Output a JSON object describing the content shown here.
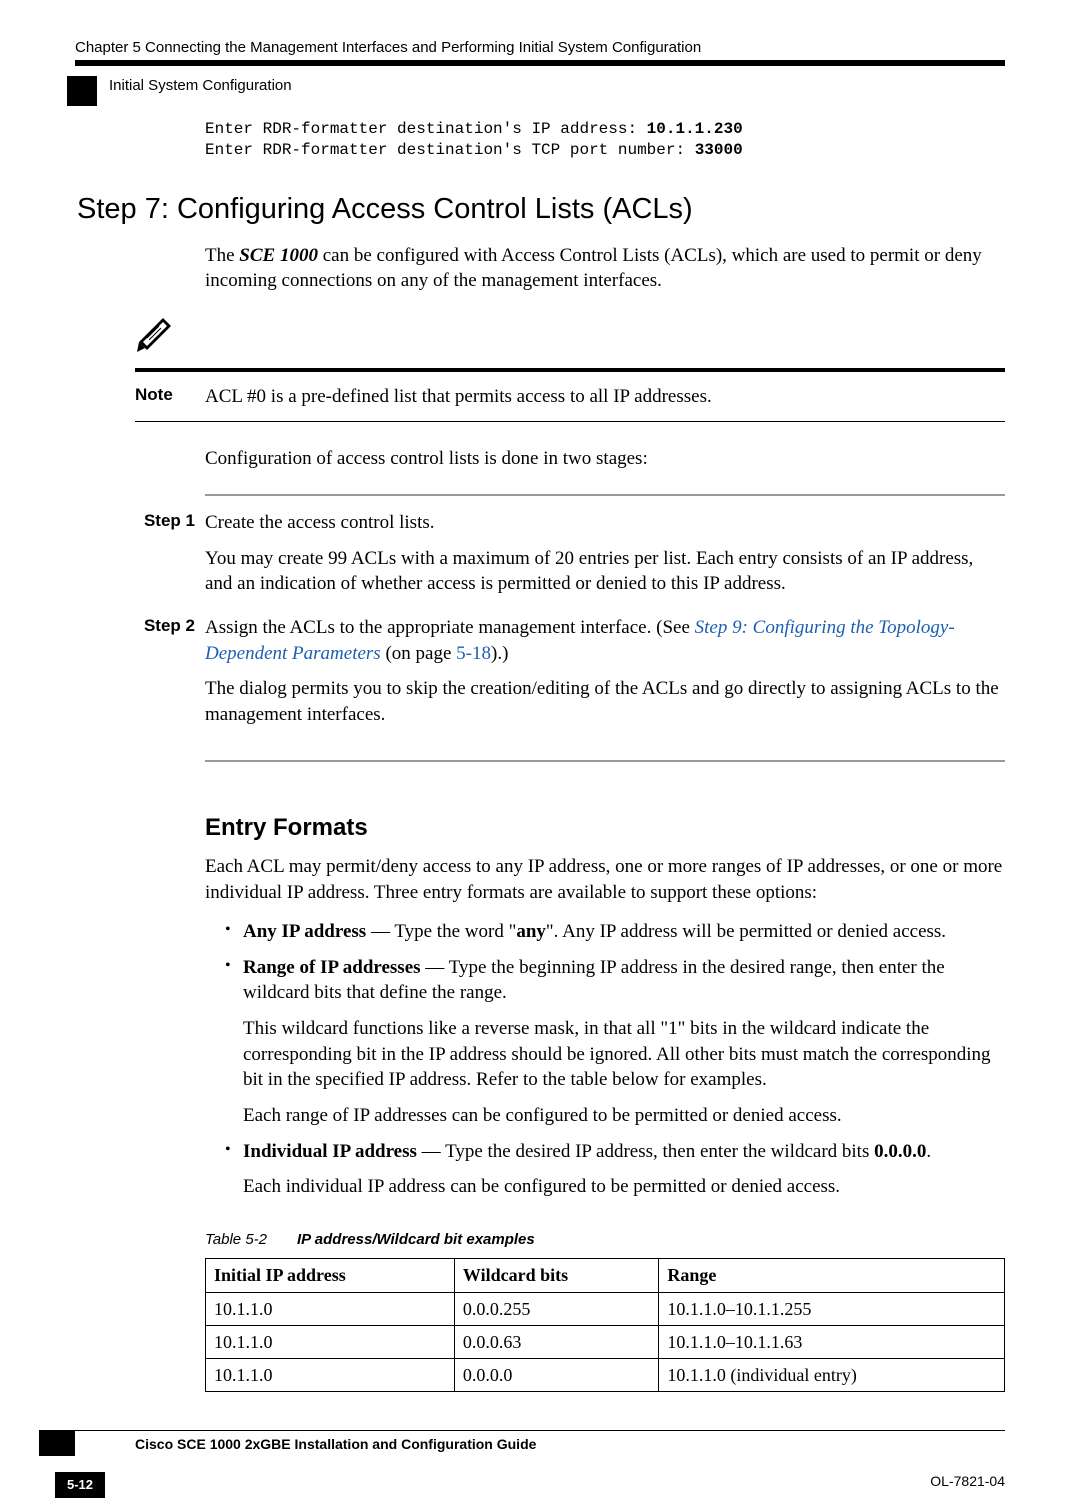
{
  "header": {
    "chapter": "Chapter 5      Connecting the Management Interfaces and Performing Initial System Configuration",
    "section": "Initial System Configuration"
  },
  "code": {
    "line1_label": "Enter RDR-formatter destination's IP address: ",
    "line1_value": "10.1.1.230",
    "line2_label": "Enter RDR-formatter destination's TCP port number: ",
    "line2_value": "33000"
  },
  "title": "Step 7: Configuring Access Control Lists (ACLs)",
  "intro_pre": "The ",
  "intro_device": "SCE 1000",
  "intro_post": " can be configured with Access Control Lists (ACLs), which are used to permit or deny incoming connections on any of the management interfaces.",
  "note": {
    "label": "Note",
    "text": "ACL #0 is a pre-defined list that permits access to all IP addresses."
  },
  "config_intro": "Configuration of access control lists is done in two stages:",
  "steps": {
    "s1_label": "Step 1",
    "s1_p1": "Create the access control lists.",
    "s1_p2": "You may create 99 ACLs with a maximum of 20 entries per list. Each entry consists of an IP address, and an indication of whether access is permitted or denied to this IP address.",
    "s2_label": "Step 2",
    "s2_pre": "Assign the ACLs to the appropriate management interface. (See ",
    "s2_link": "Step 9: Configuring the Topology-Dependent Parameters",
    "s2_mid": " (on page ",
    "s2_page": "5-18",
    "s2_post": ").)",
    "s2_p2": "The dialog permits you to skip the creation/editing of the ACLs and go directly to assigning ACLs to the management interfaces."
  },
  "entry": {
    "heading": "Entry Formats",
    "intro": "Each ACL may permit/deny access to any IP address, one or more ranges of IP addresses, or one or more individual IP address. Three entry formats are available to support these options:",
    "li1_label": "Any IP address",
    "li1_text_a": " — Type the word \"",
    "li1_text_b": "any",
    "li1_text_c": "\". Any IP address will be permitted or denied access.",
    "li2_label": "Range of IP addresses",
    "li2_text": " — Type the beginning IP address in the desired range, then enter the wildcard bits that define the range.",
    "li2_p2": "This wildcard functions like a reverse mask, in that all \"1\" bits in the wildcard indicate the corresponding bit in the IP address should be ignored. All other bits must match the corresponding bit in the specified IP address. Refer to the table below for examples.",
    "li2_p3": "Each range of IP addresses can be configured to be permitted or denied access.",
    "li3_label": "Individual IP address",
    "li3_text_a": " — Type the desired IP address, then enter the wildcard bits ",
    "li3_text_b": "0.0.0.0",
    "li3_text_c": ".",
    "li3_p2": "Each individual IP address can be configured to be permitted or denied access."
  },
  "table": {
    "caption_num": "Table 5-2",
    "caption_title": "IP address/Wildcard bit examples",
    "headers": [
      "Initial IP address",
      "Wildcard bits",
      "Range"
    ],
    "rows": [
      [
        "10.1.1.0",
        "0.0.0.255",
        "10.1.1.0–10.1.1.255"
      ],
      [
        "10.1.1.0",
        "0.0.0.63",
        "10.1.1.0–10.1.1.63"
      ],
      [
        "10.1.1.0",
        "0.0.0.0",
        "10.1.1.0 (individual entry)"
      ]
    ]
  },
  "footer": {
    "title": "Cisco SCE 1000 2xGBE Installation and Configuration Guide",
    "pagenum": "5-12",
    "docid": "OL-7821-04"
  }
}
